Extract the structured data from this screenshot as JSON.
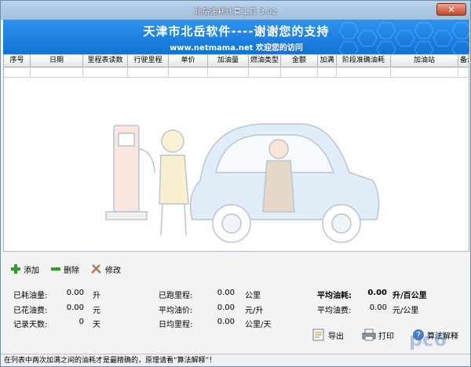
{
  "window": {
    "title": "北岳油耗计算工具 3.02",
    "close_label": "✕"
  },
  "banner": {
    "title": "天津市北岳软件----谢谢您的支持",
    "subtitle": "www.netmama.net 欢迎您的访问"
  },
  "grid": {
    "columns": [
      "序号",
      "日期",
      "里程表读数",
      "行驶里程",
      "单价",
      "加油量",
      "燃油类型",
      "金额",
      "加满",
      "阶段准确油耗",
      "加油站",
      "备注"
    ]
  },
  "toolbar": {
    "add": "添加",
    "delete": "删除",
    "edit": "修改"
  },
  "stats": {
    "consumed_fuel": {
      "label": "已耗油量:",
      "value": "0.00",
      "unit": "升"
    },
    "spent_fuel": {
      "label": "已花油费:",
      "value": "0.00",
      "unit": "元"
    },
    "record_days": {
      "label": "记录天数:",
      "value": "0",
      "unit": "天"
    },
    "run_mileage": {
      "label": "已跑里程:",
      "value": "0.00",
      "unit": "公里"
    },
    "avg_price": {
      "label": "平均油价:",
      "value": "0.00",
      "unit": "元/升"
    },
    "daily_mileage": {
      "label": "日均里程:",
      "value": "0.00",
      "unit": "公里/天"
    },
    "avg_consumption": {
      "label": "平均油耗:",
      "value": "0.00",
      "unit": "升/百公里"
    },
    "avg_cost": {
      "label": "平均油费:",
      "value": "0.00",
      "unit": "元/公里"
    }
  },
  "actions": {
    "export": "导出",
    "print": "打印",
    "algo": "算法解释"
  },
  "statusbar": {
    "text": "在列表中两次加满之间的油耗才是最精确的，原理请看“算法解释”！"
  },
  "watermark": {
    "text": "pc6"
  },
  "colors": {
    "banner": "#1d7fe0",
    "title_bar": "#a8c8e6",
    "add_icon": "#2e9e2e",
    "delete_icon": "#2e9e2e"
  }
}
